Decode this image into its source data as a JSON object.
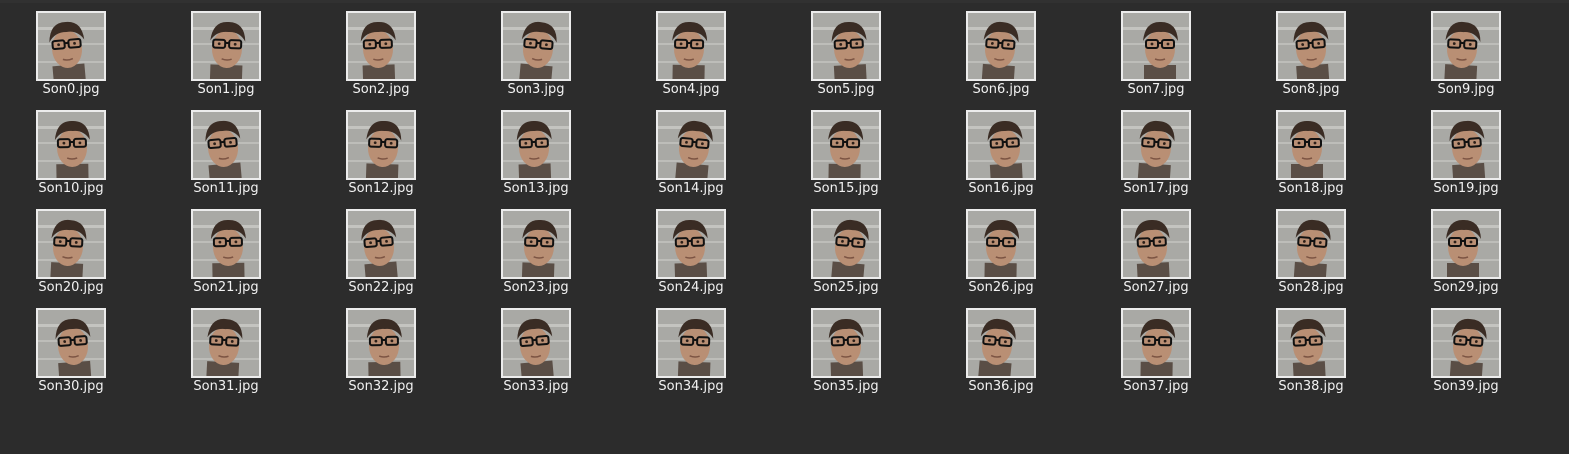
{
  "file_view": {
    "files": [
      {
        "name": "Son0.jpg",
        "icon": "image-thumbnail-icon"
      },
      {
        "name": "Son1.jpg",
        "icon": "image-thumbnail-icon"
      },
      {
        "name": "Son2.jpg",
        "icon": "image-thumbnail-icon"
      },
      {
        "name": "Son3.jpg",
        "icon": "image-thumbnail-icon"
      },
      {
        "name": "Son4.jpg",
        "icon": "image-thumbnail-icon"
      },
      {
        "name": "Son5.jpg",
        "icon": "image-thumbnail-icon"
      },
      {
        "name": "Son6.jpg",
        "icon": "image-thumbnail-icon"
      },
      {
        "name": "Son7.jpg",
        "icon": "image-thumbnail-icon"
      },
      {
        "name": "Son8.jpg",
        "icon": "image-thumbnail-icon"
      },
      {
        "name": "Son9.jpg",
        "icon": "image-thumbnail-icon"
      },
      {
        "name": "Son10.jpg",
        "icon": "image-thumbnail-icon"
      },
      {
        "name": "Son11.jpg",
        "icon": "image-thumbnail-icon"
      },
      {
        "name": "Son12.jpg",
        "icon": "image-thumbnail-icon"
      },
      {
        "name": "Son13.jpg",
        "icon": "image-thumbnail-icon"
      },
      {
        "name": "Son14.jpg",
        "icon": "image-thumbnail-icon"
      },
      {
        "name": "Son15.jpg",
        "icon": "image-thumbnail-icon"
      },
      {
        "name": "Son16.jpg",
        "icon": "image-thumbnail-icon"
      },
      {
        "name": "Son17.jpg",
        "icon": "image-thumbnail-icon"
      },
      {
        "name": "Son18.jpg",
        "icon": "image-thumbnail-icon"
      },
      {
        "name": "Son19.jpg",
        "icon": "image-thumbnail-icon"
      },
      {
        "name": "Son20.jpg",
        "icon": "image-thumbnail-icon"
      },
      {
        "name": "Son21.jpg",
        "icon": "image-thumbnail-icon"
      },
      {
        "name": "Son22.jpg",
        "icon": "image-thumbnail-icon"
      },
      {
        "name": "Son23.jpg",
        "icon": "image-thumbnail-icon"
      },
      {
        "name": "Son24.jpg",
        "icon": "image-thumbnail-icon"
      },
      {
        "name": "Son25.jpg",
        "icon": "image-thumbnail-icon"
      },
      {
        "name": "Son26.jpg",
        "icon": "image-thumbnail-icon"
      },
      {
        "name": "Son27.jpg",
        "icon": "image-thumbnail-icon"
      },
      {
        "name": "Son28.jpg",
        "icon": "image-thumbnail-icon"
      },
      {
        "name": "Son29.jpg",
        "icon": "image-thumbnail-icon"
      },
      {
        "name": "Son30.jpg",
        "icon": "image-thumbnail-icon"
      },
      {
        "name": "Son31.jpg",
        "icon": "image-thumbnail-icon"
      },
      {
        "name": "Son32.jpg",
        "icon": "image-thumbnail-icon"
      },
      {
        "name": "Son33.jpg",
        "icon": "image-thumbnail-icon"
      },
      {
        "name": "Son34.jpg",
        "icon": "image-thumbnail-icon"
      },
      {
        "name": "Son35.jpg",
        "icon": "image-thumbnail-icon"
      },
      {
        "name": "Son36.jpg",
        "icon": "image-thumbnail-icon"
      },
      {
        "name": "Son37.jpg",
        "icon": "image-thumbnail-icon"
      },
      {
        "name": "Son38.jpg",
        "icon": "image-thumbnail-icon"
      },
      {
        "name": "Son39.jpg",
        "icon": "image-thumbnail-icon"
      }
    ]
  },
  "colors": {
    "background": "#2c2c2c",
    "text": "#f2f2f2",
    "thumbnail_border": "#ececec"
  }
}
